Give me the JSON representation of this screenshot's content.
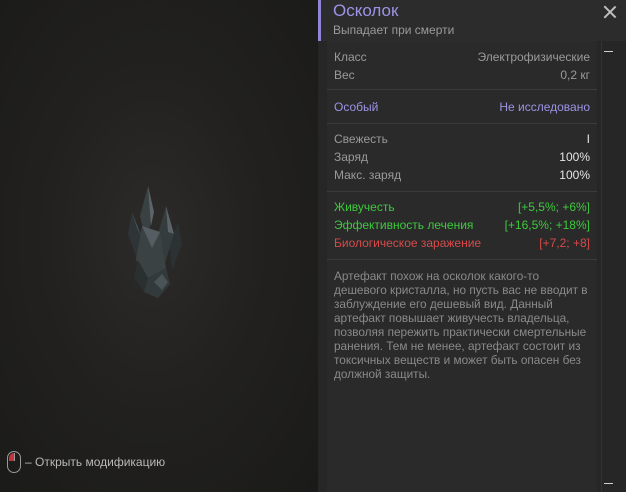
{
  "viewport": {
    "hint_text": "– Открыть модификацию",
    "mouse_icon": "mouse-left-click-icon",
    "artifact_icon": "crystal-shard-icon"
  },
  "header": {
    "title": "Осколок",
    "subtitle": "Выпадает при смерти"
  },
  "stats": {
    "class_label": "Класс",
    "class_value": "Электрофизические",
    "weight_label": "Вес",
    "weight_value": "0,2 кг"
  },
  "special": {
    "label": "Особый",
    "value": "Не исследовано"
  },
  "state": {
    "freshness_label": "Свежесть",
    "freshness_value": "I",
    "charge_label": "Заряд",
    "charge_value": "100%",
    "max_charge_label": "Макс. заряд",
    "max_charge_value": "100%"
  },
  "effects": [
    {
      "label": "Живучесть",
      "value": "[+5,5%; +6%]"
    },
    {
      "label": "Эффективность лечения",
      "value": "[+16,5%; +18%]"
    },
    {
      "label": "Биологическое заражение",
      "value": "[+7,2; +8]"
    }
  ],
  "description": "Артефакт похож на осколок какого-то дешевого кристалла, но пусть вас не вводит в заблуждение его дешевый вид. Данный артефакт повышает живучесть владельца, позволяя пережить практически смертельные ранения. Тем не менее, артефакт состоит из токсичных веществ и может быть опасен без должной защиты.",
  "colors": {
    "accent": "#9d93e6",
    "positive": "#3ec93e",
    "negative": "#d84a4a"
  }
}
